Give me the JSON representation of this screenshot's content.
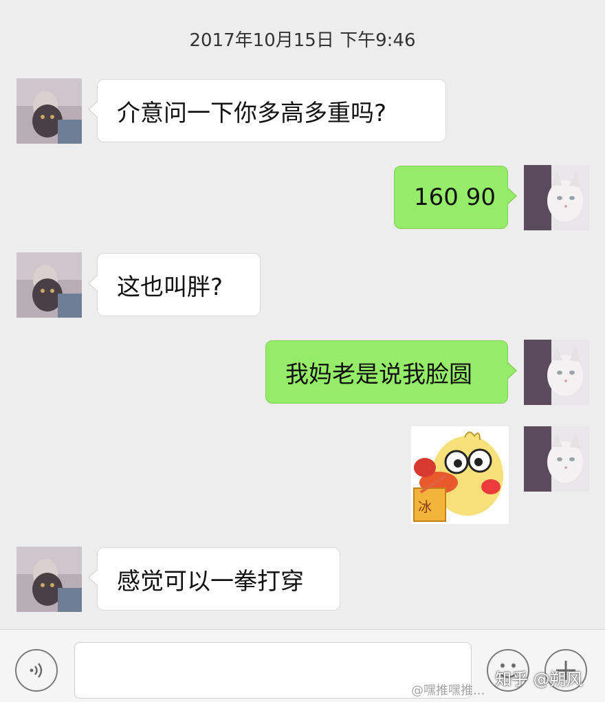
{
  "timestamp": "2017年10月15日 下午9:46",
  "messages": [
    {
      "side": "left",
      "text": "介意问一下你多高多重吗?"
    },
    {
      "side": "right",
      "text": "160 90"
    },
    {
      "side": "left",
      "text": "这也叫胖?"
    },
    {
      "side": "right",
      "text": "我妈老是说我脸圆"
    },
    {
      "side": "right",
      "sticker": "duck-sticker"
    },
    {
      "side": "left",
      "text": "感觉可以一拳打穿"
    }
  ],
  "input": {
    "value": "",
    "placeholder": ""
  },
  "icons": {
    "voice": "voice-icon",
    "emoji": "emoji-icon",
    "plus": "plus-icon"
  },
  "watermark": {
    "zhihu": "知乎 @朔风",
    "weibo": "@嘿推嘿推..."
  },
  "colors": {
    "sent_bubble": "#95ec69",
    "received_bubble": "#ffffff",
    "chat_background": "#ededed"
  }
}
